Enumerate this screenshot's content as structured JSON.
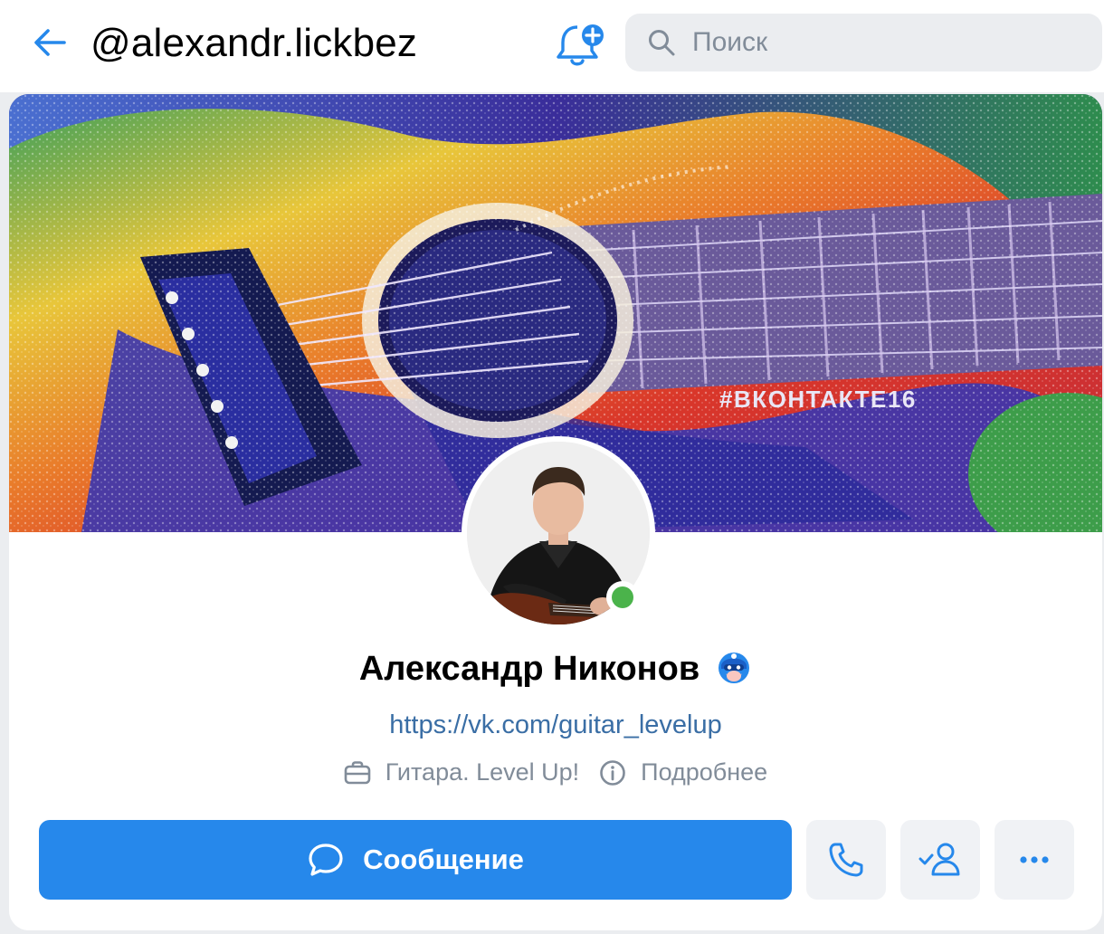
{
  "header": {
    "handle": "@alexandr.lickbez",
    "search_placeholder": "Поиск"
  },
  "cover": {
    "hashtag": "#ВКОНТАКТЕ16"
  },
  "profile": {
    "name": "Александр Никонов",
    "link": "https://vk.com/guitar_levelup",
    "work": "Гитара. Level Up!",
    "more_label": "Подробнее",
    "online": true
  },
  "actions": {
    "message_label": "Сообщение"
  },
  "colors": {
    "accent": "#2688eb",
    "online": "#4bb34b",
    "secondary_text": "#818c99"
  },
  "icons": [
    "back-arrow-icon",
    "bell-plus-icon",
    "search-icon",
    "verified-mascot-icon",
    "briefcase-icon",
    "info-icon",
    "message-bubble-icon",
    "phone-icon",
    "friend-check-icon",
    "more-dots-icon"
  ]
}
